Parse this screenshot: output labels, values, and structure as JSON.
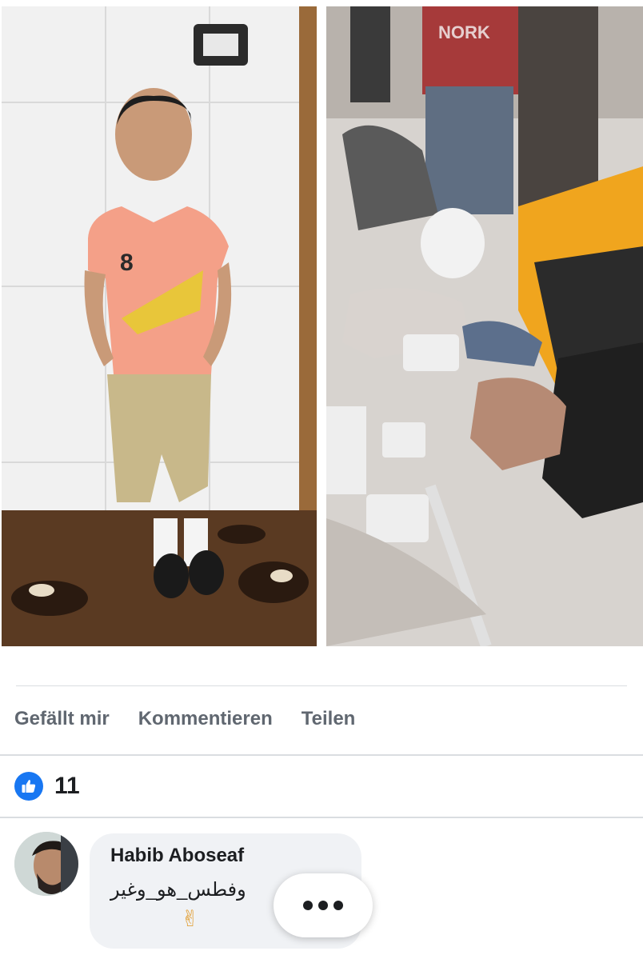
{
  "post": {
    "photos": [
      {
        "description_icon": "child-photo"
      },
      {
        "description_icon": "rescue-scene-photo"
      }
    ]
  },
  "actions": {
    "like_label": "Gefällt mir",
    "comment_label": "Kommentieren",
    "share_label": "Teilen"
  },
  "reactions": {
    "icon": "thumbs-up-icon",
    "count": "11",
    "color": "#1877f2"
  },
  "comment": {
    "author": "Habib Aboseaf",
    "text": "وفطس_هو_وغير",
    "emoji": "✌",
    "more_icon": "more-dots-icon"
  }
}
